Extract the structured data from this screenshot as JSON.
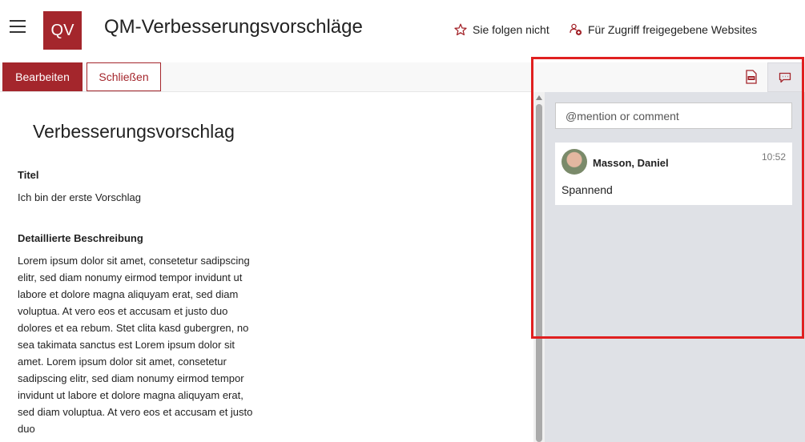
{
  "header": {
    "logo_text": "QV",
    "site_title": "QM-Verbesserungsvorschläge",
    "follow_label": "Sie folgen nicht",
    "shared_label": "Für Zugriff freigegebene Websites"
  },
  "commandbar": {
    "edit_label": "Bearbeiten",
    "close_label": "Schließen"
  },
  "form": {
    "heading": "Verbesserungsvorschlag",
    "fields": [
      {
        "label": "Titel",
        "value": "Ich bin der erste Vorschlag"
      },
      {
        "label": "Detaillierte Beschreibung",
        "value": "Lorem ipsum dolor sit amet, consetetur sadipscing elitr, sed diam nonumy eirmod tempor invidunt ut labore et dolore magna aliquyam erat, sed diam voluptua. At vero eos et accusam et justo duo dolores et ea rebum. Stet clita kasd gubergren, no sea takimata sanctus est Lorem ipsum dolor sit amet. Lorem ipsum dolor sit amet, consetetur sadipscing elitr, sed diam nonumy eirmod tempor invidunt ut labore et dolore magna aliquyam erat, sed diam voluptua. At vero eos et accusam et justo duo"
      }
    ]
  },
  "comments": {
    "input_placeholder": "@mention or comment",
    "items": [
      {
        "author": "Masson, Daniel",
        "time": "10:52",
        "text": "Spannend"
      }
    ]
  },
  "icons": {
    "menu": "hamburger-icon",
    "follow": "star-icon",
    "shared": "shared-sites-icon",
    "export": "export-csv-icon",
    "comments": "comment-icon"
  },
  "colors": {
    "brand": "#a4262c",
    "highlight": "#e02020",
    "pane_background": "#dfe1e6"
  }
}
